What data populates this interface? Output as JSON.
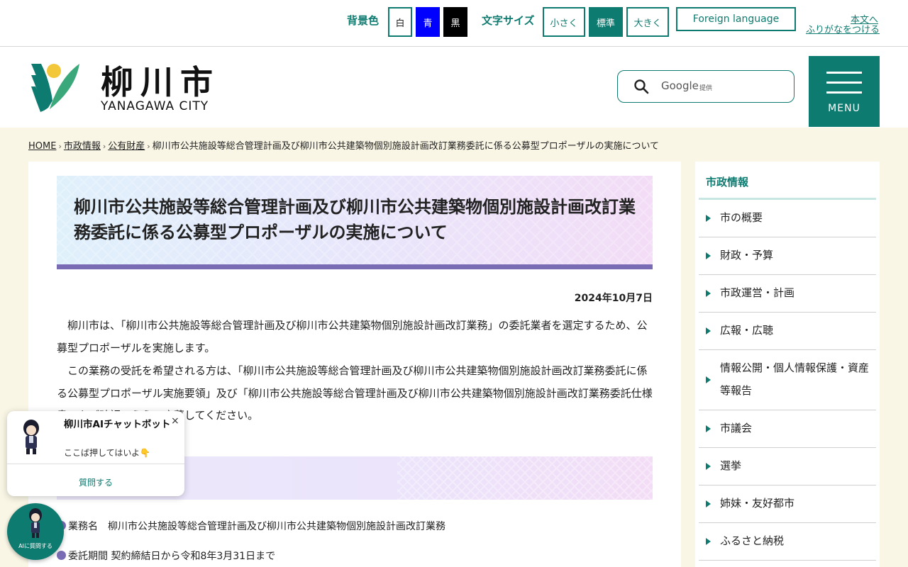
{
  "topbar": {
    "bg_color_label": "背景色",
    "bg_white": "白",
    "bg_blue": "青",
    "bg_black": "黒",
    "font_size_label": "文字サイズ",
    "font_small": "小さく",
    "font_standard": "標準",
    "font_large": "大きく",
    "foreign_language": "Foreign language",
    "skip_to_content": "本文へ",
    "furigana": "ふりがなをつける"
  },
  "header": {
    "site_name_jp": "柳川市",
    "site_name_en": "YANAGAWA CITY",
    "search_provider": "Google",
    "search_provider_suffix": "提供",
    "menu_label": "MENU"
  },
  "breadcrumb": {
    "items": [
      "HOME",
      "市政情報",
      "公有財産"
    ],
    "current": "柳川市公共施設等総合管理計画及び柳川市公共建築物個別施設計画改訂業務委託に係る公募型プロポーザルの実施について"
  },
  "article": {
    "title": "柳川市公共施設等総合管理計画及び柳川市公共建築物個別施設計画改訂業務委託に係る公募型プロポーザルの実施について",
    "date": "2024年10月7日",
    "paragraph1": "柳川市は、「柳川市公共施設等総合管理計画及び柳川市公共建築物個別施設計画改訂業務」の委託業者を選定するため、公募型プロポーザルを実施します。",
    "paragraph2": "この業務の受託を希望される方は、「柳川市公共施設等総合管理計画及び柳川市公共建築物個別施設計画改訂業務委託に係る公募型プロポーザル実施要領」及び「柳川市公共施設等総合管理計画及び柳川市公共建築物個別施設計画改訂業務委託仕様書」をご確認のうえ、応募してください。",
    "details": [
      {
        "label": "業務名",
        "value": "柳川市公共施設等総合管理計画及び柳川市公共建築物個別施設計画改訂業務"
      },
      {
        "label": "委託期間",
        "value": "契約締結日から令和8年3月31日まで"
      }
    ]
  },
  "sidebar": {
    "heading": "市政情報",
    "items": [
      "市の概要",
      "財政・予算",
      "市政運営・計画",
      "広報・広聴",
      "情報公開・個人情報保護・資産等報告",
      "市議会",
      "選挙",
      "姉妹・友好都市",
      "ふるさと納税"
    ]
  },
  "chat": {
    "title": "柳川市AIチャットボット",
    "subtitle": "ここば押してはいよ👇",
    "close": "×",
    "ask": "質問する",
    "bubble_label": "AIに質問する"
  },
  "colors": {
    "brand_green": "#0e7b70",
    "title_accent_purple": "#7a6bb5",
    "page_background": "#f9f6e5"
  }
}
